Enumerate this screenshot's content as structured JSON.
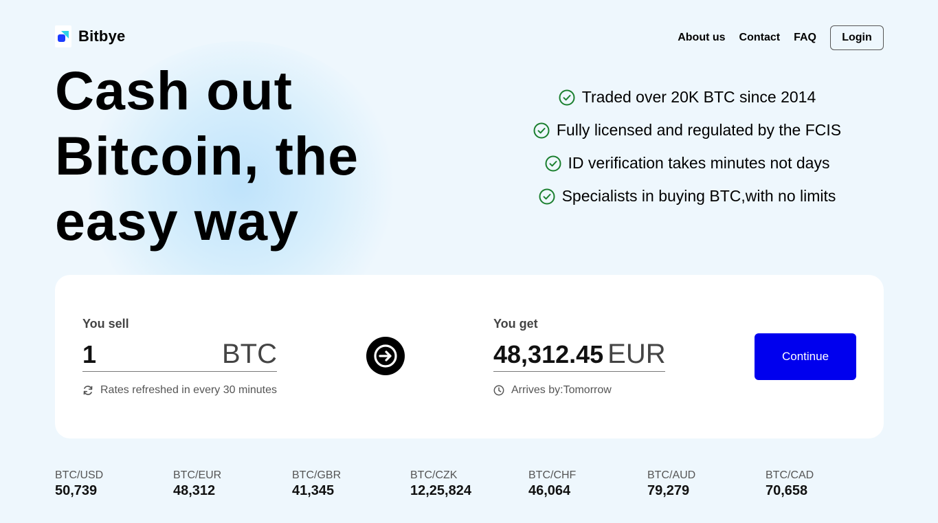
{
  "header": {
    "brand": "Bitbye",
    "nav": [
      "About us",
      "Contact",
      "FAQ"
    ],
    "login_label": "Login"
  },
  "hero": {
    "title_lines": [
      "Cash out",
      "Bitcoin, the",
      "easy way"
    ]
  },
  "features": [
    "Traded over 20K BTC since 2014",
    "Fully licensed and regulated by the FCIS",
    "ID verification takes minutes not days",
    "Specialists in buying BTC,with no limits"
  ],
  "converter": {
    "sell_label": "You sell",
    "sell_amount": "1",
    "sell_currency": "BTC",
    "sell_hint": "Rates refreshed in every 30 minutes",
    "get_label": "You get",
    "get_amount": "48,312.45",
    "get_currency": "EUR",
    "get_hint": "Arrives by:Tomorrow",
    "continue_label": "Continue"
  },
  "rates": [
    {
      "pair": "BTC/USD",
      "value": "50,739"
    },
    {
      "pair": "BTC/EUR",
      "value": "48,312"
    },
    {
      "pair": "BTC/GBR",
      "value": "41,345"
    },
    {
      "pair": "BTC/CZK",
      "value": "12,25,824"
    },
    {
      "pair": "BTC/CHF",
      "value": "46,064"
    },
    {
      "pair": "BTC/AUD",
      "value": "79,279"
    },
    {
      "pair": "BTC/CAD",
      "value": "70,658"
    }
  ],
  "colors": {
    "accent": "#0000ee",
    "check": "#1a7f2e",
    "background": "#eef7fd"
  }
}
